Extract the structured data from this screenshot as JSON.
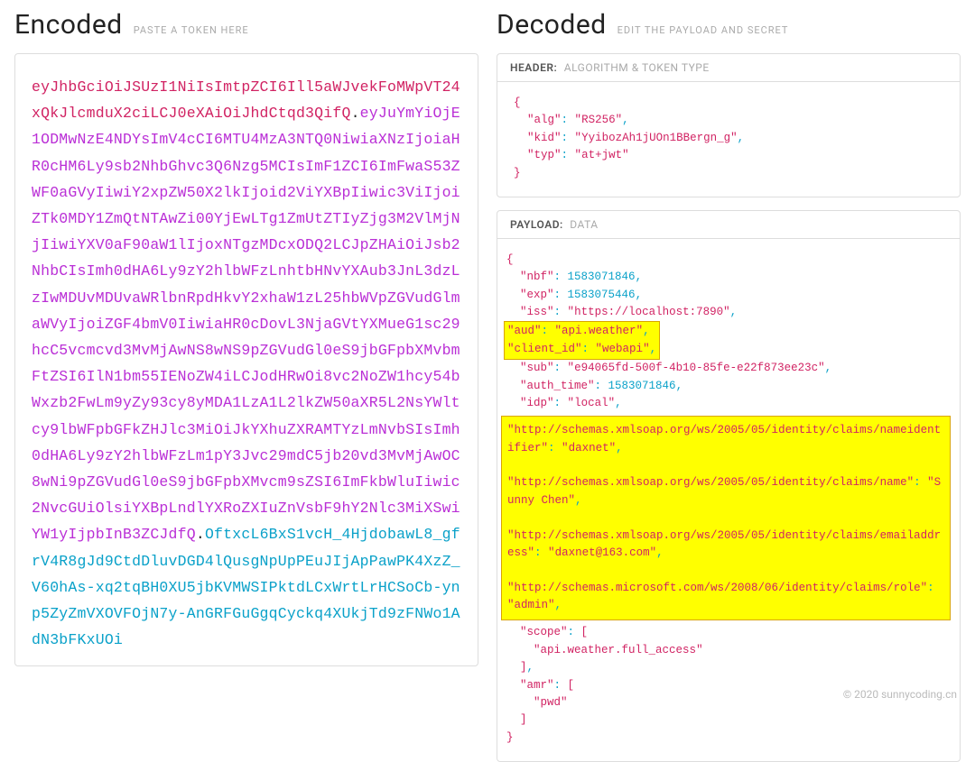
{
  "encoded": {
    "title": "Encoded",
    "subtitle": "PASTE A TOKEN HERE",
    "header": "eyJhbGciOiJSUzI1NiIsImtpZCI6Ill5aWJvekFoMWpVT24xQkJlcmduX2ciLCJ0eXAiOiJhdCtqd3QifQ",
    "payload": "eyJuYmYiOjE1ODMwNzE4NDYsImV4cCI6MTU4MzA3NTQ0NiwiaXNzIjoiaHR0cHM6Ly9sb2NhbGhvc3Q6Nzg5MCIsImF1ZCI6ImFwaS53ZWF0aGVyIiwiY2xpZW50X2lkIjoid2ViYXBpIiwic3ViIjoiZTk0MDY1ZmQtNTAwZi00YjEwLTg1ZmUtZTIyZjg3M2VlMjNjIiwiYXV0aF90aW1lIjoxNTgzMDcxODQ2LCJpZHAiOiJsb2NhbCIsImh0dHA6Ly9zY2hlbWFzLnhtbHNvYXAub3JnL3dzLzIwMDUvMDUvaWRlbnRpdHkvY2xhaW1zL25hbWVpZGVudGlmaWVyIjoiZGF4bmV0IiwiaHR0cDovL3NjaGVtYXMueG1sc29hcC5vcmcvd3MvMjAwNS8wNS9pZGVudGl0eS9jbGFpbXMvbmFtZSI6IlN1bm55IENoZW4iLCJodHRwOi8vc2NoZW1hcy54bWxzb2FwLm9yZy93cy8yMDA1LzA1L2lkZW50aXR5L2NsYWltcy9lbWFpbGFkZHJlc3MiOiJkYXhuZXRAMTYzLmNvbSIsImh0dHA6Ly9zY2hlbWFzLm1pY3Jvc29mdC5jb20vd3MvMjAwOC8wNi9pZGVudGl0eS9jbGFpbXMvcm9sZSI6ImFkbWluIiwic2NvcGUiOlsiYXBpLndlYXRoZXIuZnVsbF9hY2Nlc3MiXSwiYW1yIjpbInB3ZCJdfQ",
    "signature": "OftxcL6BxS1vcH_4HjdobawL8_gfrV4R8gJd9CtdDluvDGD4lQusgNpUpPEuJIjApPawPK4XzZ_V60hAs-xq2tqBH0XU5jbKVMWSIPktdLCxWrtLrHCSoCb-ynp5ZyZmVXOVFOjN7y-AnGRFGuGgqCyckq4XUkjTd9zFNWo1AdN3bFKxUOi"
  },
  "decoded": {
    "title": "Decoded",
    "subtitle": "EDIT THE PAYLOAD AND SECRET",
    "header": {
      "label": "HEADER:",
      "desc": "ALGORITHM & TOKEN TYPE",
      "data": {
        "alg": "RS256",
        "kid": "YyibozAh1jUOn1BBergn_g",
        "typ": "at+jwt"
      }
    },
    "payload": {
      "label": "PAYLOAD:",
      "desc": "DATA",
      "nbf": 1583071846,
      "exp": 1583075446,
      "iss": "https://localhost:7890",
      "aud": "api.weather",
      "client_id": "webapi",
      "sub": "e94065fd-500f-4b10-85fe-e22f873ee23c",
      "auth_time": 1583071846,
      "idp": "local",
      "claim_nameid_key": "http://schemas.xmlsoap.org/ws/2005/05/identity/claims/nameidentifier",
      "claim_nameid_val": "daxnet",
      "claim_name_key": "http://schemas.xmlsoap.org/ws/2005/05/identity/claims/name",
      "claim_name_val": "Sunny Chen",
      "claim_email_key": "http://schemas.xmlsoap.org/ws/2005/05/identity/claims/emailaddress",
      "claim_email_val": "daxnet@163.com",
      "claim_role_key": "http://schemas.microsoft.com/ws/2008/06/identity/claims/role",
      "claim_role_val": "admin",
      "scope0": "api.weather.full_access",
      "amr0": "pwd"
    }
  },
  "footer": "© 2020 sunnycoding.cn"
}
